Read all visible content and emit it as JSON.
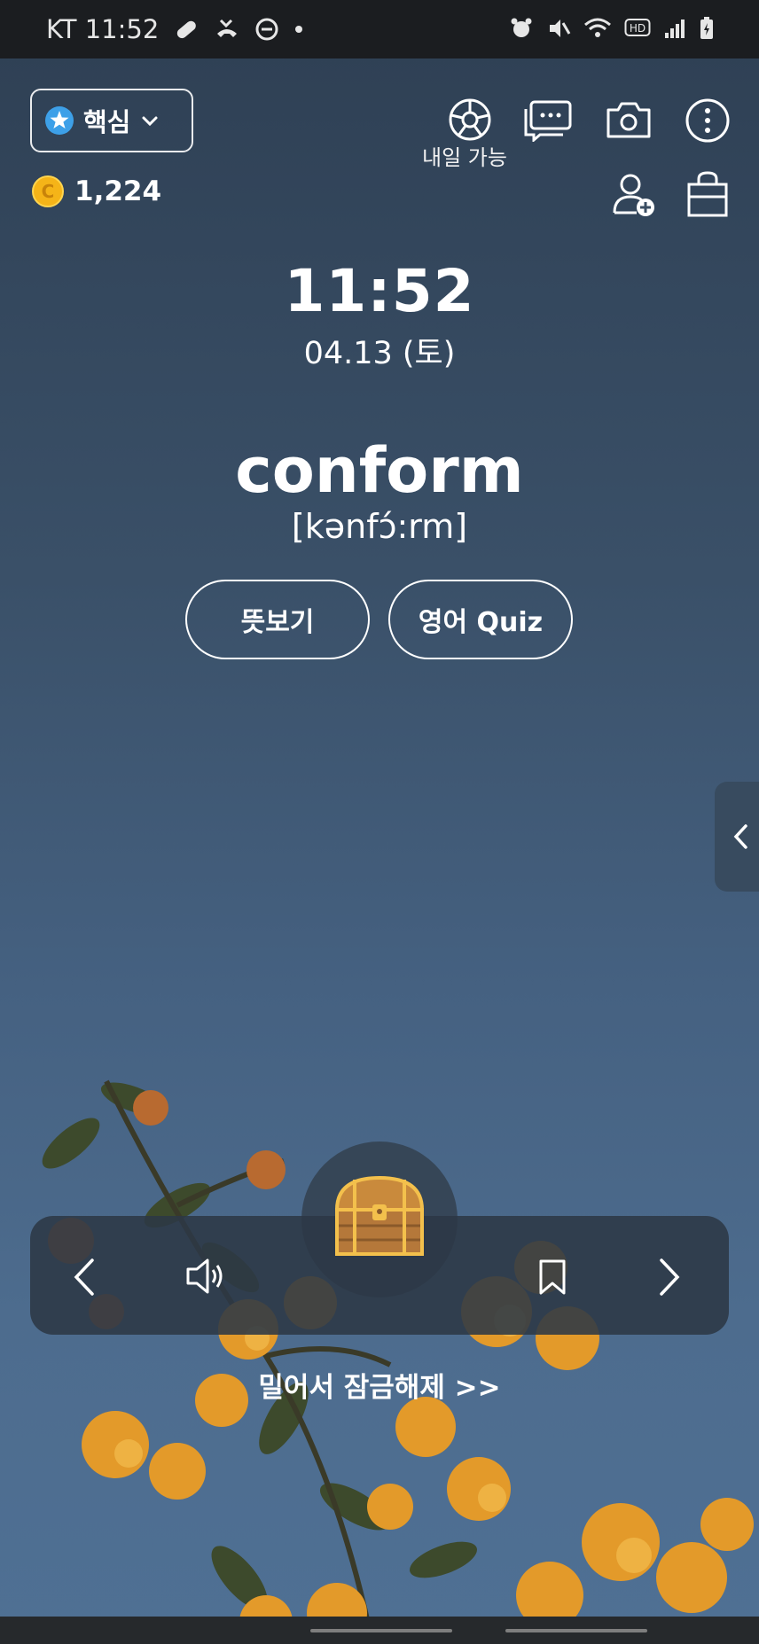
{
  "status_bar": {
    "carrier_time": "KT 11:52"
  },
  "deck": {
    "label": "핵심"
  },
  "coins": {
    "value": "1,224"
  },
  "toolbar": {
    "spin_label": "내일 가능"
  },
  "clock": {
    "time": "11:52",
    "date": "04.13 (토)"
  },
  "word": {
    "term": "conform",
    "pronunciation": "[kənfɔ́:rm]"
  },
  "buttons": {
    "meaning": "뜻보기",
    "quiz": "영어 Quiz"
  },
  "unlock": {
    "text": "밀어서 잠금해제 >>"
  },
  "colors": {
    "accent_coin": "#f5b418",
    "chest": "#c98a3c"
  }
}
